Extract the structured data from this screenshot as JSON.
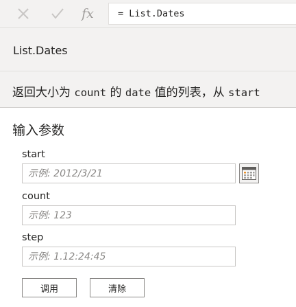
{
  "formula_bar": {
    "cancel_icon": "close-icon",
    "commit_icon": "checkmark-icon",
    "fx_label": "fx",
    "formula": "= List.Dates"
  },
  "function": {
    "name": "List.Dates",
    "description": {
      "part1": "返回大小为 ",
      "code1": "count",
      "part2": " 的 ",
      "code2": "date",
      "part3": " 值的列表，从 ",
      "code3": "start"
    }
  },
  "params": {
    "heading": "输入参数",
    "start": {
      "label": "start",
      "placeholder": "示例: 2012/3/21",
      "value": ""
    },
    "count": {
      "label": "count",
      "placeholder": "示例: 123",
      "value": ""
    },
    "step": {
      "label": "step",
      "placeholder": "示例: 1.12:24:45",
      "value": ""
    },
    "calendar_icon": "calendar-icon"
  },
  "actions": {
    "invoke_label": "调用",
    "clear_label": "清除"
  }
}
